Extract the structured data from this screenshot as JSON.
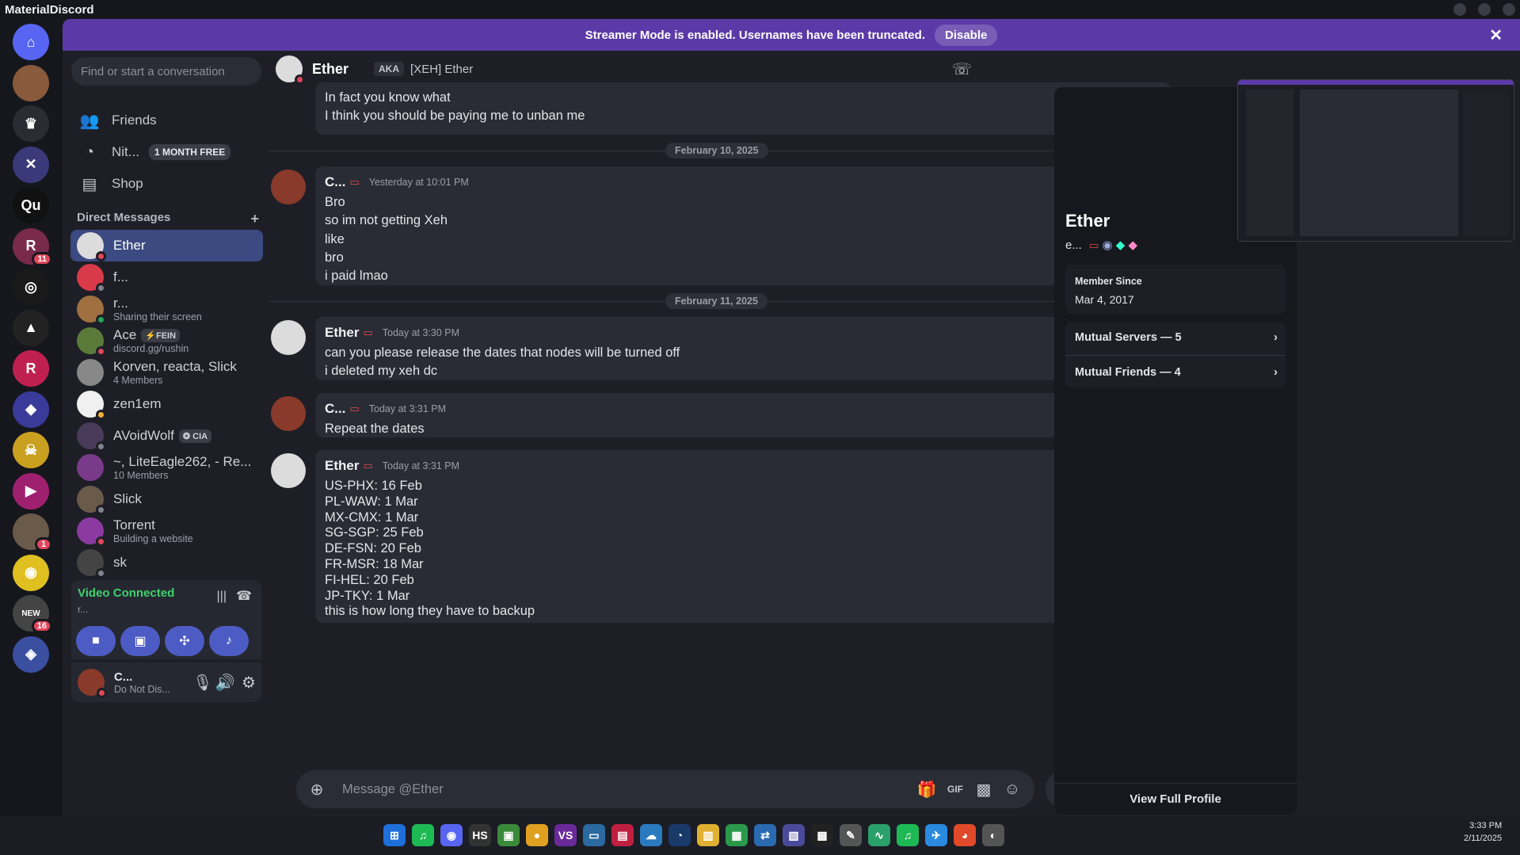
{
  "app": {
    "title": "MaterialDiscord"
  },
  "banner": {
    "text": "Streamer Mode is enabled. Usernames have been truncated.",
    "disable": "Disable",
    "close": "✕"
  },
  "servers": [
    {
      "label": "⌂",
      "color": "#5865f2",
      "badge": ""
    },
    {
      "label": "",
      "color": "#8a5a3c",
      "badge": ""
    },
    {
      "label": "♛",
      "color": "#2a2b33",
      "badge": ""
    },
    {
      "label": "✕",
      "color": "#3a3a7a",
      "badge": ""
    },
    {
      "label": "Qu",
      "color": "#111",
      "badge": ""
    },
    {
      "label": "R",
      "color": "#7a2a4a",
      "badge": "11"
    },
    {
      "label": "◎",
      "color": "#1a1a1a",
      "badge": ""
    },
    {
      "label": "▲",
      "color": "#222",
      "badge": ""
    },
    {
      "label": "R",
      "color": "#c02050",
      "badge": ""
    },
    {
      "label": "◆",
      "color": "#3a3a9a",
      "badge": ""
    },
    {
      "label": "☠",
      "color": "#c9a020",
      "badge": ""
    },
    {
      "label": "▶",
      "color": "#a02070",
      "badge": ""
    },
    {
      "label": "",
      "color": "#6a5a4a",
      "badge": "1"
    },
    {
      "label": "◉",
      "color": "#e0c020",
      "badge": ""
    },
    {
      "label": "NEW",
      "color": "#444",
      "badge": "16"
    },
    {
      "label": "◈",
      "color": "#3a4fa0",
      "badge": ""
    }
  ],
  "sidebar": {
    "search_placeholder": "Find or start a conversation",
    "friends": "Friends",
    "nitro": "Nit...",
    "nitro_badge": "1 MONTH FREE",
    "shop": "Shop",
    "dm_header": "Direct Messages",
    "dm_add": "+",
    "dms": [
      {
        "name": "Ether",
        "sub": "",
        "tag": "",
        "color": "#dcdcdc",
        "status": "#e0465a",
        "active": true
      },
      {
        "name": "f...",
        "sub": "",
        "tag": "",
        "color": "#d83a4a",
        "status": "#80848e",
        "active": false
      },
      {
        "name": "r...",
        "sub": "Sharing their screen",
        "tag": "",
        "color": "#a07040",
        "status": "#23a55a",
        "active": false
      },
      {
        "name": "Ace",
        "sub": "discord.gg/rushin",
        "tag": "⚡FEIN",
        "color": "#5a7a3a",
        "status": "#e0465a",
        "active": false
      },
      {
        "name": "Korven, reacta, Slick",
        "sub": "4 Members",
        "tag": "",
        "color": "#888",
        "status": "",
        "active": false
      },
      {
        "name": "zen1em",
        "sub": "",
        "tag": "",
        "color": "#f0f0f0",
        "status": "#f0b232",
        "active": false
      },
      {
        "name": "AVoidWolf",
        "sub": "",
        "tag": "❂ CIA",
        "color": "#4a3a5a",
        "status": "#80848e",
        "active": false
      },
      {
        "name": "~, LiteEagle262, - Re...",
        "sub": "10 Members",
        "tag": "",
        "color": "#7a3a8a",
        "status": "",
        "active": false
      },
      {
        "name": "Slick",
        "sub": "",
        "tag": "",
        "color": "#6a5a4a",
        "status": "#80848e",
        "active": false
      },
      {
        "name": "Torrent",
        "sub": "Building a website",
        "tag": "",
        "color": "#8a3aa0",
        "status": "#e0465a",
        "active": false
      },
      {
        "name": "sk",
        "sub": "",
        "tag": "",
        "color": "#444",
        "status": "#80848e",
        "active": false
      }
    ]
  },
  "voice": {
    "title": "Video Connected",
    "sub": "r..."
  },
  "user": {
    "name": "C...",
    "status": "Do Not Dis..."
  },
  "chat": {
    "name": "Ether",
    "aka": "AKA",
    "aka_value": "[XEH] Ether",
    "placeholder": "Message @Ether",
    "dates": [
      "February 10, 2025",
      "February 11, 2025"
    ],
    "messages": [
      {
        "author": "",
        "time": "",
        "lines": [
          "In fact you know what",
          "I think you should be paying me to unban me"
        ]
      },
      {
        "author": "C...",
        "time": "Yesterday at 10:01 PM",
        "lines": [
          "Bro",
          "so im not getting Xeh",
          "like",
          "bro",
          "i paid lmao"
        ]
      },
      {
        "author": "Ether",
        "time": "Today at 3:30 PM",
        "lines": [
          "can you please release the dates that nodes will be turned off",
          "i deleted my xeh dc"
        ]
      },
      {
        "author": "C...",
        "time": "Today at 3:31 PM",
        "lines": [
          "Repeat the dates"
        ]
      },
      {
        "author": "Ether",
        "time": "Today at 3:31 PM",
        "lines": [
          "US-PHX: 16 Feb",
          "PL-WAW: 1 Mar",
          "MX-CMX: 1 Mar",
          "SG-SGP: 25 Feb",
          "DE-FSN: 20 Feb",
          "FR-MSR: 18 Mar",
          "FI-HEL: 20 Feb",
          "JP-TKY: 1 Mar",
          "this is how long they have to backup"
        ]
      }
    ]
  },
  "profile": {
    "name": "Ether",
    "handle": "e...",
    "member_since_label": "Member Since",
    "member_since": "Mar 4, 2017",
    "mutual_servers": "Mutual Servers — 5",
    "mutual_friends": "Mutual Friends — 4",
    "view_full": "View Full Profile"
  },
  "taskbar": {
    "time": "3:33 PM",
    "date": "2/11/2025",
    "apps": [
      "⊞",
      "♫",
      "◉",
      "HS",
      "▣",
      "●",
      "VS",
      "▭",
      "▤",
      "☁",
      "◔",
      "▥",
      "▦",
      "⇄",
      "▧",
      "▩",
      "✎",
      "∿",
      "♫",
      "✈",
      "◕",
      "◐"
    ]
  }
}
